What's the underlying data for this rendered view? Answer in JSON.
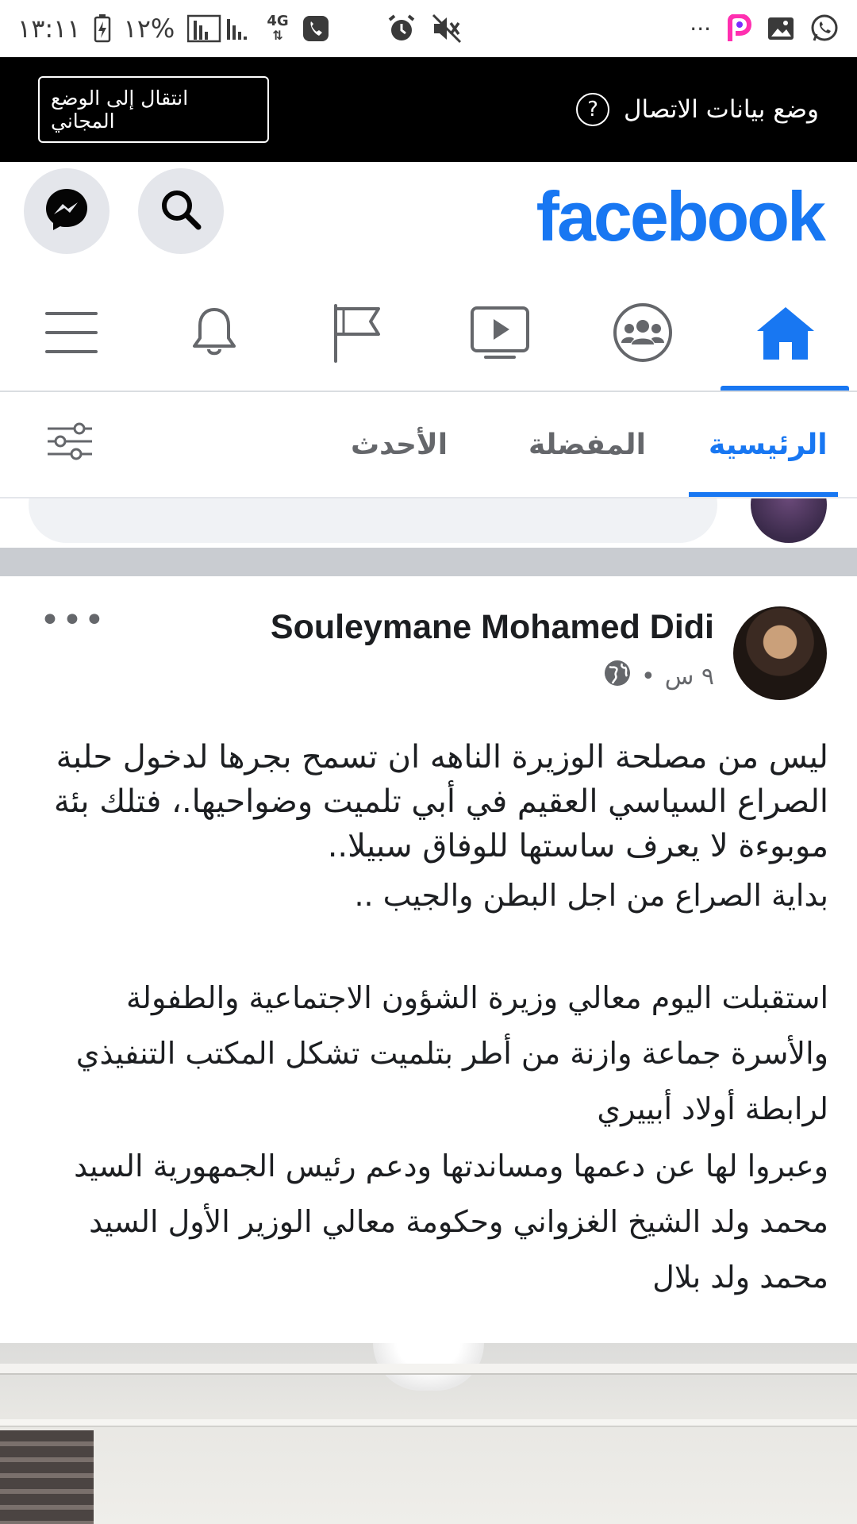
{
  "status_bar": {
    "time": "١٣:١١",
    "battery": "١٢%",
    "network": "4G",
    "more": "···"
  },
  "data_banner": {
    "title": "وضع بيانات الاتصال",
    "help_glyph": "?",
    "free_mode_button": "انتقال إلى الوضع المجاني"
  },
  "header": {
    "logo": "facebook",
    "brand_color": "#1877f2"
  },
  "nav": {
    "items": [
      "home-icon",
      "groups-icon",
      "watch-icon",
      "pages-icon",
      "notifications-icon",
      "menu-icon"
    ],
    "active": "home-icon"
  },
  "feed_tabs": {
    "home": "الرئيسية",
    "favorites": "المفضلة",
    "recent": "الأحدث"
  },
  "post": {
    "author": "Souleymane Mohamed Didi",
    "time": "٩ س",
    "separator": "•",
    "intro_text": "ليس من مصلحة الوزيرة الناهه ان تسمح بجرها لدخول حلبة الصراع السياسي العقيم في أبي تلميت وضواحيها.، فتلك بئة موبوءة لا يعرف ساستها للوفاق سبيلا..",
    "line_2": "بداية الصراع من اجل البطن والجيب ..",
    "para_1": "استقبلت اليوم معالي وزيرة الشؤون الاجتماعية والطفولة والأسرة جماعة وازنة من أطر بتلميت تشكل المكتب التنفيذي لرابطة أولاد أبييري",
    "para_2": "وعبروا لها عن دعمها ومساندتها ودعم رئيس الجمهورية السيد محمد ولد الشيخ الغزواني وحكومة معالي الوزير الأول السيد محمد ولد بلال",
    "more": "•••"
  }
}
